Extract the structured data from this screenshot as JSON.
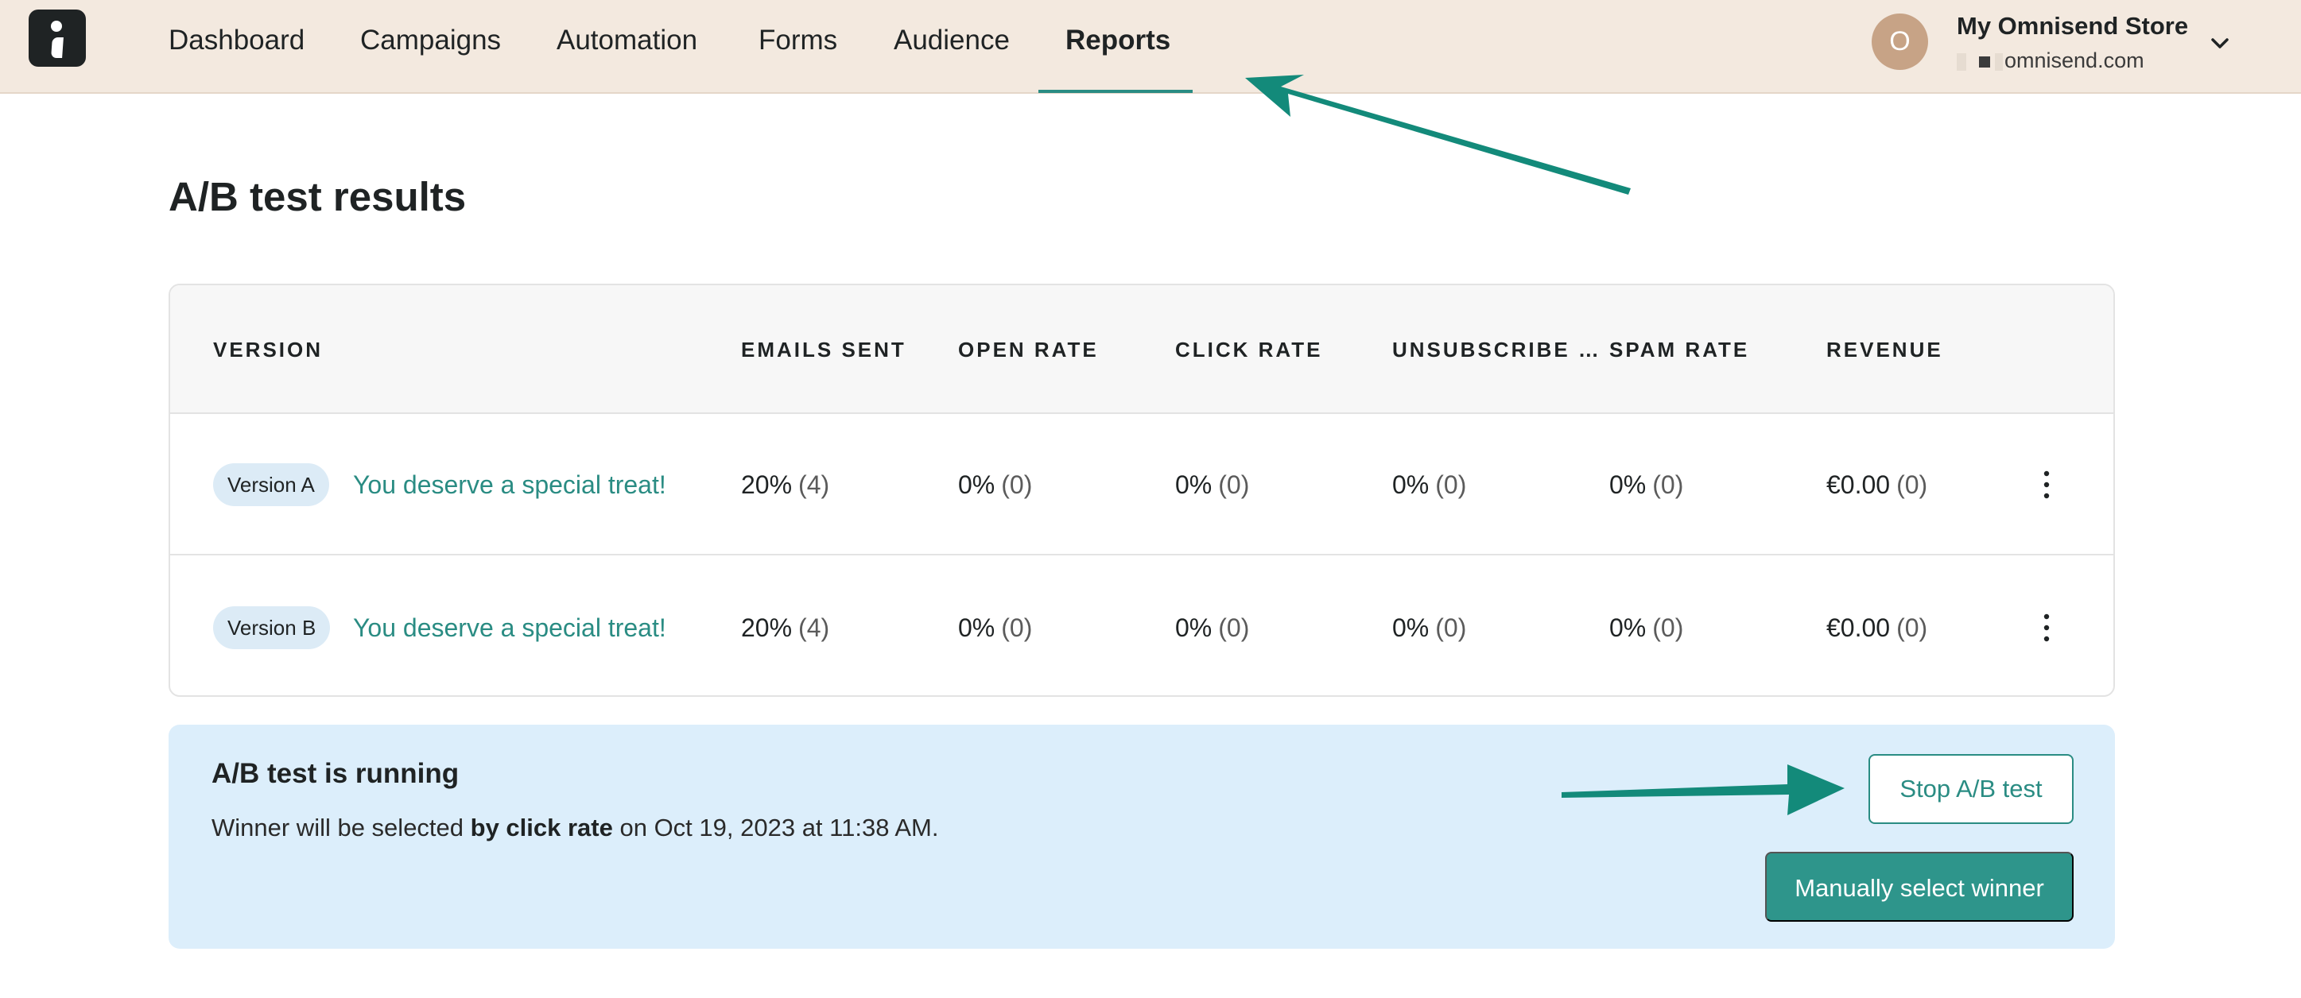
{
  "nav": {
    "items": [
      {
        "label": "Dashboard",
        "active": false
      },
      {
        "label": "Campaigns",
        "active": false
      },
      {
        "label": "Automation",
        "active": false
      },
      {
        "label": "Forms",
        "active": false
      },
      {
        "label": "Audience",
        "active": false
      },
      {
        "label": "Reports",
        "active": true
      }
    ]
  },
  "account": {
    "avatar_letter": "O",
    "store_name": "My Omnisend Store",
    "store_domain": "omnisend.com"
  },
  "page": {
    "title": "A/B test results"
  },
  "table": {
    "columns": [
      "VERSION",
      "EMAILS SENT",
      "OPEN RATE",
      "CLICK RATE",
      "UNSUBSCRIBE …",
      "SPAM RATE",
      "REVENUE"
    ],
    "rows": [
      {
        "version": "Version A",
        "subject": "You deserve a special treat!",
        "emails_sent": {
          "value": "20%",
          "count": "(4)"
        },
        "open_rate": {
          "value": "0%",
          "count": "(0)"
        },
        "click_rate": {
          "value": "0%",
          "count": "(0)"
        },
        "unsubscribe_rate": {
          "value": "0%",
          "count": "(0)"
        },
        "spam_rate": {
          "value": "0%",
          "count": "(0)"
        },
        "revenue": {
          "value": "€0.00",
          "count": "(0)"
        }
      },
      {
        "version": "Version B",
        "subject": "You deserve a special treat!",
        "emails_sent": {
          "value": "20%",
          "count": "(4)"
        },
        "open_rate": {
          "value": "0%",
          "count": "(0)"
        },
        "click_rate": {
          "value": "0%",
          "count": "(0)"
        },
        "unsubscribe_rate": {
          "value": "0%",
          "count": "(0)"
        },
        "spam_rate": {
          "value": "0%",
          "count": "(0)"
        },
        "revenue": {
          "value": "€0.00",
          "count": "(0)"
        }
      }
    ]
  },
  "status": {
    "title": "A/B test is running",
    "text_before": "Winner will be selected ",
    "text_bold": "by click rate",
    "text_after": " on Oct 19, 2023 at 11:38 AM.",
    "stop_button": "Stop A/B test",
    "winner_button": "Manually select winner"
  },
  "colors": {
    "accent": "#2a8c83",
    "topbar": "#f3e9df",
    "banner": "#dceefb",
    "annotation_arrow": "#138a7a"
  },
  "icons": {
    "logo": "omnisend-logo-icon",
    "dropdown": "chevron-down-icon",
    "row_menu": "more-vertical-icon",
    "annotation": "arrow-annotation-icon"
  }
}
